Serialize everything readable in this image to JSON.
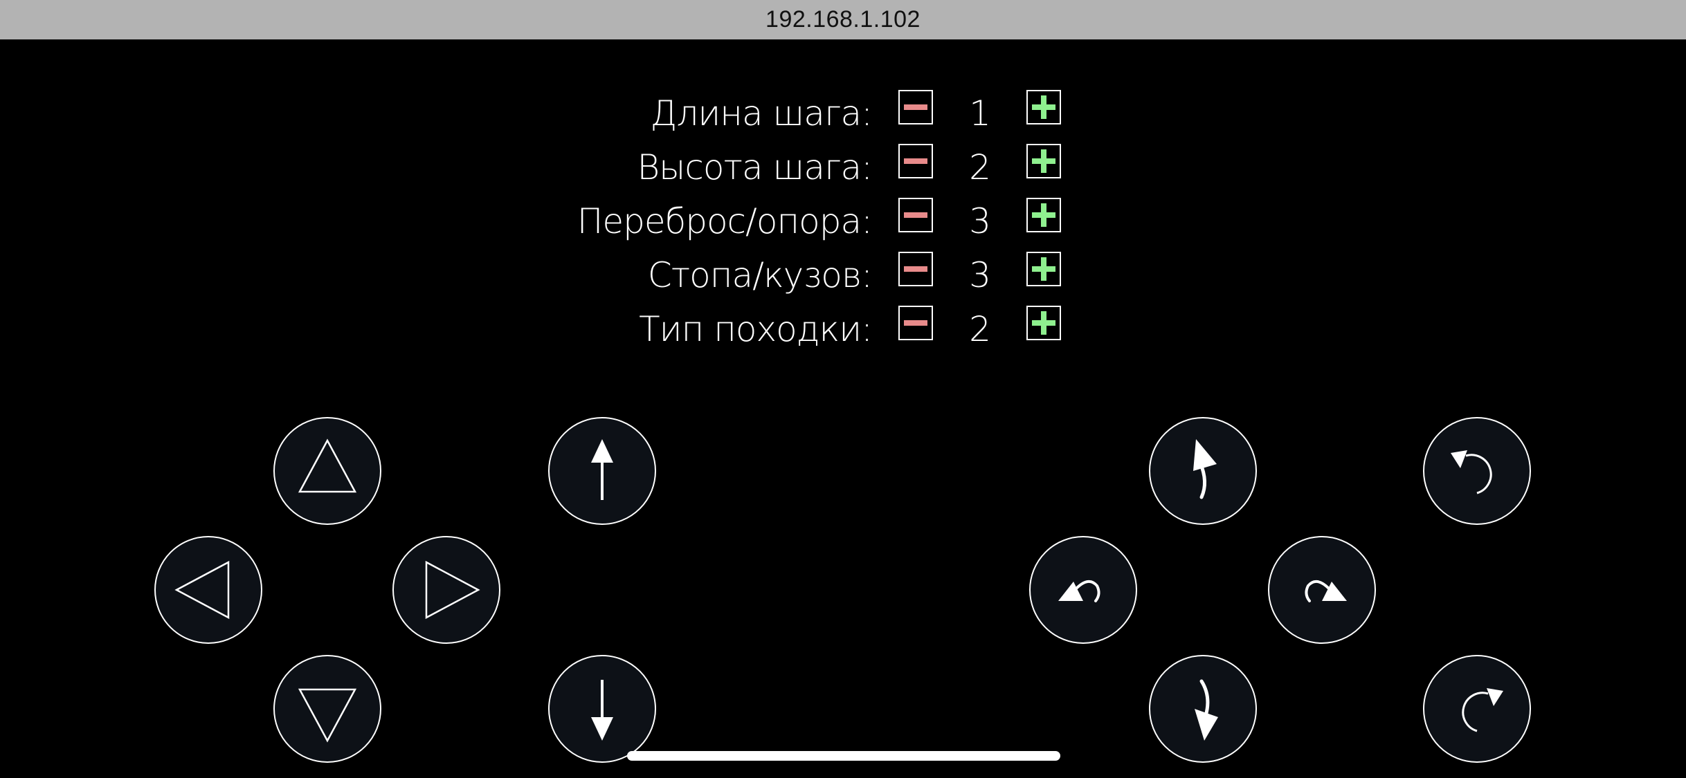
{
  "browser": {
    "url": "192.168.1.102"
  },
  "settings": [
    {
      "label": "Длина шага:",
      "value": "1"
    },
    {
      "label": "Высота шага:",
      "value": "2"
    },
    {
      "label": "Переброс/опора:",
      "value": "3"
    },
    {
      "label": "Стопа/кузов:",
      "value": "3"
    },
    {
      "label": "Тип походки:",
      "value": "2"
    }
  ],
  "controls": {
    "left_pad": [
      "triangle-up-icon",
      "triangle-left-icon",
      "triangle-right-icon",
      "triangle-down-icon"
    ],
    "center": [
      "arrow-up-icon",
      "arrow-down-icon"
    ],
    "right_pad": [
      "curve-forward-right-icon",
      "turn-left-icon",
      "turn-right-icon",
      "curve-back-icon"
    ],
    "rotate": [
      "rotate-ccw-icon",
      "rotate-cw-icon"
    ]
  },
  "colors": {
    "background": "#000000",
    "url_bar": "#b3b3b3",
    "minus": "#e88b8b",
    "plus": "#8ff08f",
    "button_fill": "#0d1117",
    "stroke": "#ffffff"
  }
}
